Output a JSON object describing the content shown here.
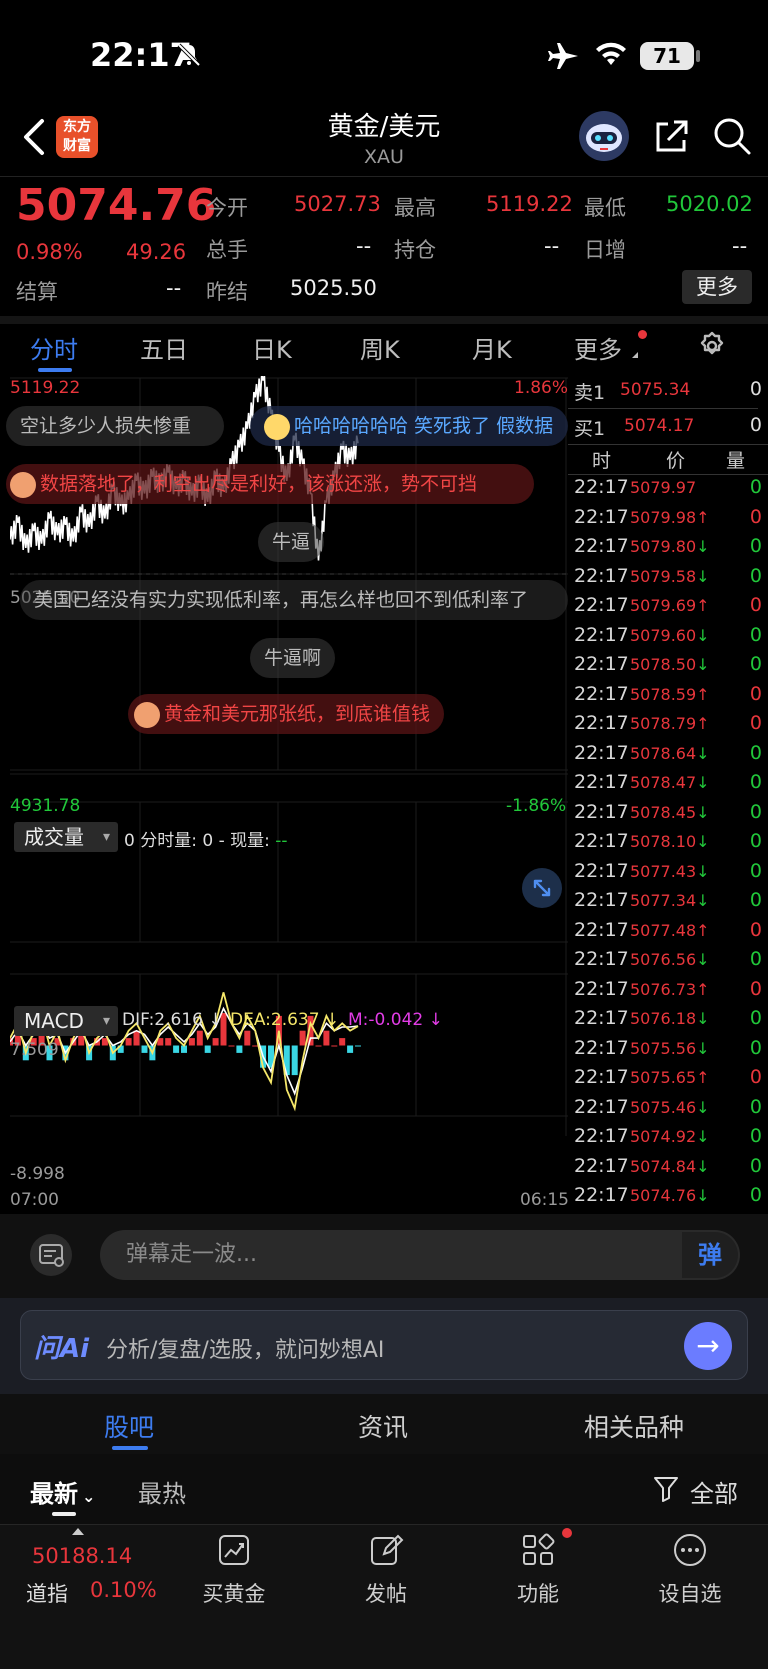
{
  "status": {
    "time": "22:17",
    "battery": "71"
  },
  "header": {
    "logo": "东方\n财富",
    "title": "黄金/美元",
    "subtitle": "XAU"
  },
  "quote": {
    "price": "5074.76",
    "change_pct": "0.98%",
    "change": "49.26",
    "open_label": "今开",
    "open": "5027.73",
    "high_label": "最高",
    "high": "5119.22",
    "low_label": "最低",
    "low": "5020.02",
    "volume_label": "总手",
    "volume": "--",
    "position_label": "持仓",
    "position": "--",
    "daily_inc_label": "日增",
    "daily_inc": "--",
    "settle_label": "结算",
    "settle": "--",
    "prev_settle_label": "昨结",
    "prev_settle": "5025.50",
    "more_label": "更多"
  },
  "tabs": [
    "分时",
    "五日",
    "日K",
    "周K",
    "月K",
    "更多"
  ],
  "chart": {
    "y_top": "5119.22",
    "y_top_pct": "1.86%",
    "y_mid": "5025.50",
    "y_bottom": "4931.78",
    "y_bottom_pct": "-1.86%",
    "volume_selector": "成交量",
    "volume_info": "0 分时量: 0 - 现量: ",
    "volume_info_dash": "--",
    "macd_selector": "MACD",
    "dif": "DIF:2.616 ↓",
    "dea": "DEA:2.637 ↓",
    "m": "M:-0.042 ↓",
    "macd_top": "7.509",
    "macd_bottom": "-8.998",
    "time_start": "07:00",
    "time_end": "06:15",
    "colors": {
      "line": "#ffffff",
      "dif": "#f5e76a",
      "dea": "#ffffff",
      "up": "#e8363c",
      "down": "#3ad6e4"
    }
  },
  "chart_data": {
    "type": "line",
    "x_range": [
      "07:00",
      "06:15"
    ],
    "ylim": [
      4931.78,
      5119.22
    ],
    "prev_settle": 5025.5,
    "series": [
      {
        "values": [
          5042,
          5050,
          5038,
          5046,
          5040,
          5052,
          5044,
          5049,
          5041,
          5055,
          5048,
          5060,
          5052,
          5066,
          5058,
          5061,
          5070,
          5064,
          5072,
          5068,
          5074,
          5066,
          5071,
          5063,
          5069,
          5060,
          5072,
          5065,
          5078,
          5086,
          5095,
          5110,
          5118,
          5102,
          5084,
          5070,
          5090,
          5078,
          5064,
          5032,
          5060,
          5072,
          5085,
          5080,
          5088
        ]
      }
    ],
    "macd": {
      "ylim": [
        -8.998,
        7.509
      ],
      "dif": [
        1,
        3,
        -1,
        2,
        4,
        0,
        2,
        -2,
        1,
        3,
        -1,
        1,
        2,
        -1,
        0,
        2,
        3,
        1,
        -1,
        2,
        3,
        1,
        0,
        2,
        4,
        1,
        3,
        7.2,
        3,
        1,
        4,
        2,
        -3,
        -5,
        2,
        -6,
        -8.5,
        -2,
        3,
        1,
        4,
        2,
        3,
        2,
        2.616
      ],
      "dea": [
        0.5,
        2,
        0,
        1.5,
        3,
        1,
        1.5,
        -1,
        0.5,
        2,
        0,
        0.5,
        1.5,
        0,
        0.5,
        1.5,
        2,
        1.5,
        0,
        1.5,
        2.5,
        1.5,
        0.5,
        1.5,
        3,
        1.5,
        2.5,
        5,
        3,
        1.5,
        3,
        2,
        -1.5,
        -3.5,
        0,
        -4,
        -6.5,
        -3,
        1,
        1,
        3,
        2,
        2.5,
        2.5,
        2.637
      ]
    }
  },
  "orderbook": {
    "ask_label": "卖1",
    "ask_price": "5075.34",
    "ask_vol": "0",
    "bid_label": "买1",
    "bid_price": "5074.17",
    "bid_vol": "0",
    "header_time": "时",
    "header_price": "价",
    "header_vol": "量"
  },
  "ticks": [
    {
      "t": "22:17",
      "p": "5079.97",
      "d": "",
      "v": "0"
    },
    {
      "t": "22:17",
      "p": "5079.98",
      "d": "↑",
      "v": "0"
    },
    {
      "t": "22:17",
      "p": "5079.80",
      "d": "↓",
      "v": "0"
    },
    {
      "t": "22:17",
      "p": "5079.58",
      "d": "↓",
      "v": "0"
    },
    {
      "t": "22:17",
      "p": "5079.69",
      "d": "↑",
      "v": "0"
    },
    {
      "t": "22:17",
      "p": "5079.60",
      "d": "↓",
      "v": "0"
    },
    {
      "t": "22:17",
      "p": "5078.50",
      "d": "↓",
      "v": "0"
    },
    {
      "t": "22:17",
      "p": "5078.59",
      "d": "↑",
      "v": "0"
    },
    {
      "t": "22:17",
      "p": "5078.79",
      "d": "↑",
      "v": "0"
    },
    {
      "t": "22:17",
      "p": "5078.64",
      "d": "↓",
      "v": "0"
    },
    {
      "t": "22:17",
      "p": "5078.47",
      "d": "↓",
      "v": "0"
    },
    {
      "t": "22:17",
      "p": "5078.45",
      "d": "↓",
      "v": "0"
    },
    {
      "t": "22:17",
      "p": "5078.10",
      "d": "↓",
      "v": "0"
    },
    {
      "t": "22:17",
      "p": "5077.43",
      "d": "↓",
      "v": "0"
    },
    {
      "t": "22:17",
      "p": "5077.34",
      "d": "↓",
      "v": "0"
    },
    {
      "t": "22:17",
      "p": "5077.48",
      "d": "↑",
      "v": "0"
    },
    {
      "t": "22:17",
      "p": "5076.56",
      "d": "↓",
      "v": "0"
    },
    {
      "t": "22:17",
      "p": "5076.73",
      "d": "↑",
      "v": "0"
    },
    {
      "t": "22:17",
      "p": "5076.18",
      "d": "↓",
      "v": "0"
    },
    {
      "t": "22:17",
      "p": "5075.56",
      "d": "↓",
      "v": "0"
    },
    {
      "t": "22:17",
      "p": "5075.65",
      "d": "↑",
      "v": "0"
    },
    {
      "t": "22:17",
      "p": "5075.46",
      "d": "↓",
      "v": "0"
    },
    {
      "t": "22:17",
      "p": "5074.92",
      "d": "↓",
      "v": "0"
    },
    {
      "t": "22:17",
      "p": "5074.84",
      "d": "↓",
      "v": "0"
    },
    {
      "t": "22:17",
      "p": "5074.76",
      "d": "↓",
      "v": "0"
    }
  ],
  "danmu": [
    "空让多少人损失惨重",
    "哈哈哈哈哈哈 笑死我了 假数据",
    "数据落地了，利空出尽是利好，该涨还涨，势不可挡",
    "牛逼",
    "美国已经没有实力实现低利率，再怎么样也回不到低利率了",
    "牛逼啊",
    "黄金和美元那张纸，到底谁值钱"
  ],
  "danmu_input": {
    "placeholder": "弹幕走一波...",
    "send": "弹"
  },
  "ai": {
    "logo": "问Ai",
    "placeholder": "分析/复盘/选股，就问妙想AI"
  },
  "community_tabs": [
    "股吧",
    "资讯",
    "相关品种"
  ],
  "filter": {
    "latest": "最新",
    "hot": "最热",
    "all": "全部"
  },
  "bottom_nav": {
    "index_value": "50188.14",
    "index_name": "道指",
    "index_pct": "0.10%",
    "items": [
      "买黄金",
      "发帖",
      "功能",
      "设自选"
    ]
  }
}
